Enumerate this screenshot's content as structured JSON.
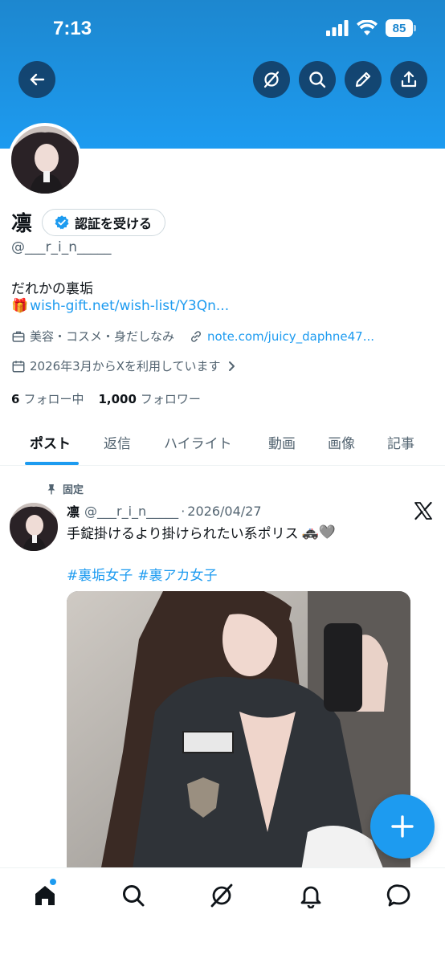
{
  "status_bar": {
    "time": "7:13",
    "battery": "85"
  },
  "profile": {
    "display_name": "凛",
    "verify_label": "認証を受ける",
    "handle": "@___r_i_n_____",
    "bio": "だれかの裏垢",
    "bio_link_emoji": "🎁",
    "bio_link": "wish-gift.net/wish-list/Y3Qn...",
    "category": "美容・コスメ・身だしなみ",
    "website": "note.com/juicy_daphne47...",
    "joined": "2026年3月からXを利用しています",
    "following_count": "6",
    "following_label": "フォロー中",
    "followers_count": "1,000",
    "followers_label": "フォロワー"
  },
  "tabs": [
    {
      "label": "ポスト"
    },
    {
      "label": "返信"
    },
    {
      "label": "ハイライト"
    },
    {
      "label": "動画"
    },
    {
      "label": "画像"
    },
    {
      "label": "記事"
    }
  ],
  "post": {
    "pinned_label": "固定",
    "author_name": "凛",
    "author_handle": "@___r_i_n_____",
    "separator": "·",
    "date": "2026/04/27",
    "text": "手錠掛けるより掛けられたい系ポリス",
    "text_emoji": "🚓🩶",
    "hashtags": [
      "#裏垢女子",
      "#裏アカ女子"
    ]
  },
  "colors": {
    "accent": "#1d9bf0",
    "banner": "#1d87cf",
    "muted": "#536471",
    "text": "#0f1419"
  },
  "icons": {
    "nav": [
      "back-arrow-icon",
      "grok-icon",
      "search-icon",
      "edit-pencil-icon",
      "share-icon"
    ],
    "bottom": [
      "home-icon",
      "search-icon",
      "grok-icon",
      "bell-icon",
      "message-icon"
    ]
  }
}
